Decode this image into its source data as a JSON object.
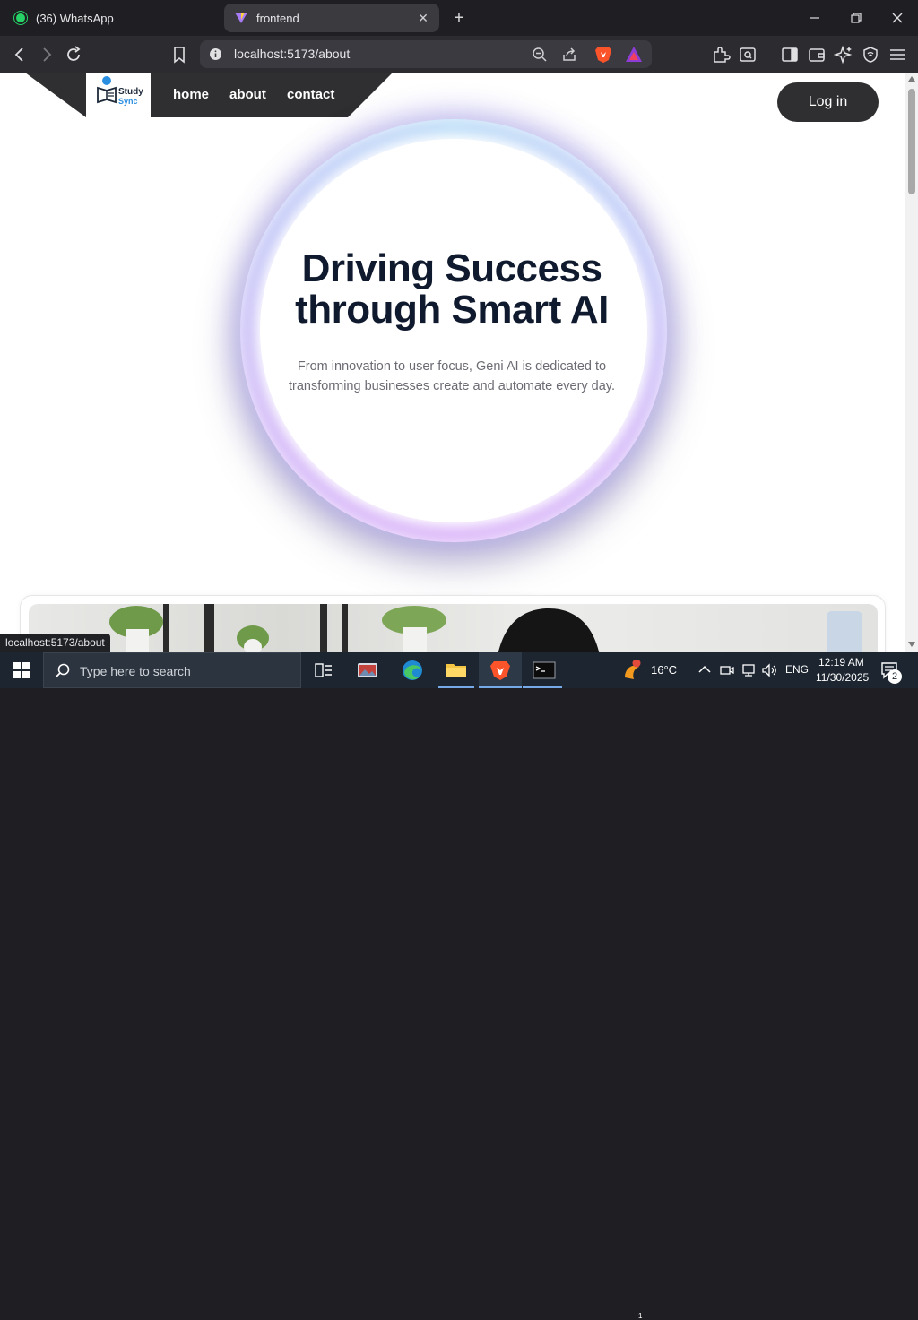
{
  "browser": {
    "tabs": [
      {
        "label": "(36) WhatsApp",
        "active": false
      },
      {
        "label": "frontend",
        "active": true
      }
    ],
    "url": "localhost:5173/about",
    "status_bar_url": "localhost:5173/about"
  },
  "site": {
    "logo": {
      "line1": "Study",
      "line2": "Sync"
    },
    "nav": [
      {
        "label": "home"
      },
      {
        "label": "about"
      },
      {
        "label": "contact"
      }
    ],
    "login_label": "Log in",
    "hero": {
      "title_line1": "Driving Success",
      "title_line2": "through Smart AI",
      "subtitle_line1": "From innovation to user focus, Geni AI is dedicated to",
      "subtitle_line2": "transforming businesses create and automate every day."
    }
  },
  "taskbar": {
    "search_placeholder": "Type here to search",
    "weather": "16°C",
    "weather_badge": "1",
    "language": "ENG",
    "time": "12:19 AM",
    "date": "11/30/2025",
    "notification_count": "2"
  },
  "colors": {
    "nav_bg": "#2f2f31",
    "hero_text": "#101a2e",
    "ring_blue": "#6fb6ef",
    "ring_purple": "#b05cf2"
  }
}
